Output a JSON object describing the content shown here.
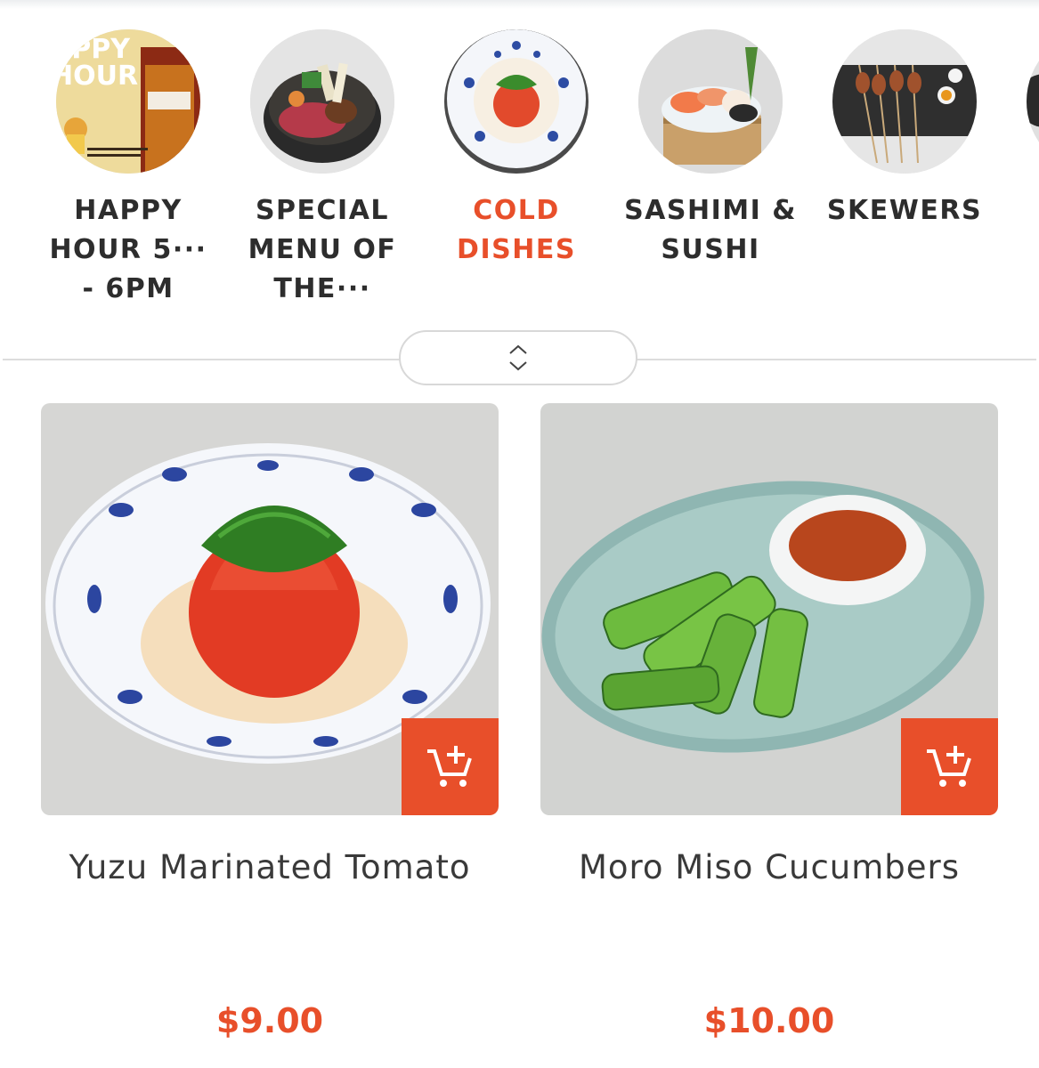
{
  "categories": [
    {
      "label": "",
      "active": false,
      "icon": "partial-category"
    },
    {
      "label": "HAPPY\nHOUR 5···\n- 6PM",
      "active": false,
      "icon": "happy-hour-beer"
    },
    {
      "label": "SPECIAL\nMENU OF\nTHE···",
      "active": false,
      "icon": "hotpot"
    },
    {
      "label": "COLD\nDISHES",
      "active": true,
      "icon": "tomato-dish"
    },
    {
      "label": "SASHIMI &\nSUSHI",
      "active": false,
      "icon": "sashimi-platter"
    },
    {
      "label": "SKEWERS",
      "active": false,
      "icon": "skewers"
    },
    {
      "label": "",
      "active": false,
      "icon": "partial-category"
    }
  ],
  "happy_hour_badge": "APPY\nHOUR",
  "toggle": {
    "icon": "chevron-up-down-icon"
  },
  "products": [
    {
      "name": "Yuzu Marinated Tomato",
      "price": "$9.00",
      "cart_icon": "add-to-cart-icon"
    },
    {
      "name": "Moro Miso Cucumbers",
      "price": "$10.00",
      "cart_icon": "add-to-cart-icon"
    }
  ],
  "colors": {
    "accent": "#e84f2a",
    "text": "#2d2d2d"
  }
}
